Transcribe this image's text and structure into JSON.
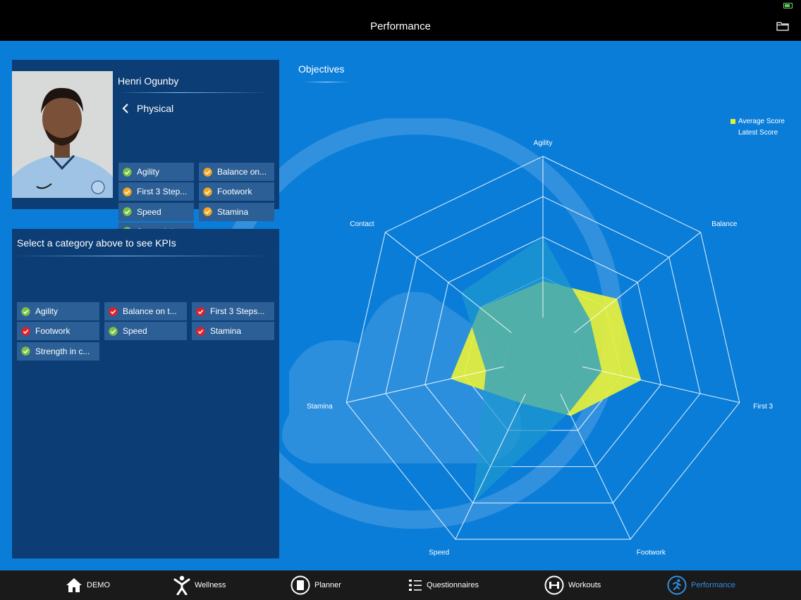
{
  "header": {
    "title": "Performance"
  },
  "player": {
    "name": "Henri Ogunby",
    "category": "Physical",
    "subcategories": [
      {
        "label": "Agility",
        "status": "green"
      },
      {
        "label": "Balance on...",
        "status": "orange"
      },
      {
        "label": "First 3 Step...",
        "status": "orange"
      },
      {
        "label": "Footwork",
        "status": "orange"
      },
      {
        "label": "Speed",
        "status": "green"
      },
      {
        "label": "Stamina",
        "status": "orange"
      },
      {
        "label": "Strength in...",
        "status": "green"
      }
    ]
  },
  "kpis": {
    "title": "Select a category above to see KPIs",
    "items": [
      {
        "label": "Agility",
        "status": "green"
      },
      {
        "label": "Balance on t...",
        "status": "red"
      },
      {
        "label": "First 3 Steps...",
        "status": "red"
      },
      {
        "label": "Footwork",
        "status": "red"
      },
      {
        "label": "Speed",
        "status": "green"
      },
      {
        "label": "Stamina",
        "status": "red"
      },
      {
        "label": "Strength in c...",
        "status": "green"
      }
    ]
  },
  "objectives": {
    "title": "Objectives",
    "legend": {
      "average": "Average Score",
      "latest": "Latest Score"
    },
    "axes": [
      "Agility",
      "Balance",
      "First 3",
      "Footwork",
      "Speed",
      "Stamina",
      "Contact"
    ],
    "levels": 5,
    "average_score": [
      0.38,
      0.47,
      0.5,
      0.32,
      0.25,
      0.47,
      0.4
    ],
    "latest_score": [
      0.6,
      0.3,
      0.3,
      0.3,
      0.8,
      0.29,
      0.52
    ]
  },
  "colors": {
    "green": "#7ac143",
    "orange": "#f5a623",
    "red": "#e02027",
    "average_fill": "#e7f13a",
    "latest_fill": "#1e98d0",
    "active_tab": "#2f8ee0"
  },
  "nav": {
    "tabs": [
      {
        "label": "DEMO",
        "icon": "home-icon"
      },
      {
        "label": "Wellness",
        "icon": "person-icon"
      },
      {
        "label": "Planner",
        "icon": "planner-icon"
      },
      {
        "label": "Questionnaires",
        "icon": "list-icon"
      },
      {
        "label": "Workouts",
        "icon": "dumbbell-icon"
      },
      {
        "label": "Performance",
        "icon": "runner-icon",
        "active": true
      }
    ]
  }
}
